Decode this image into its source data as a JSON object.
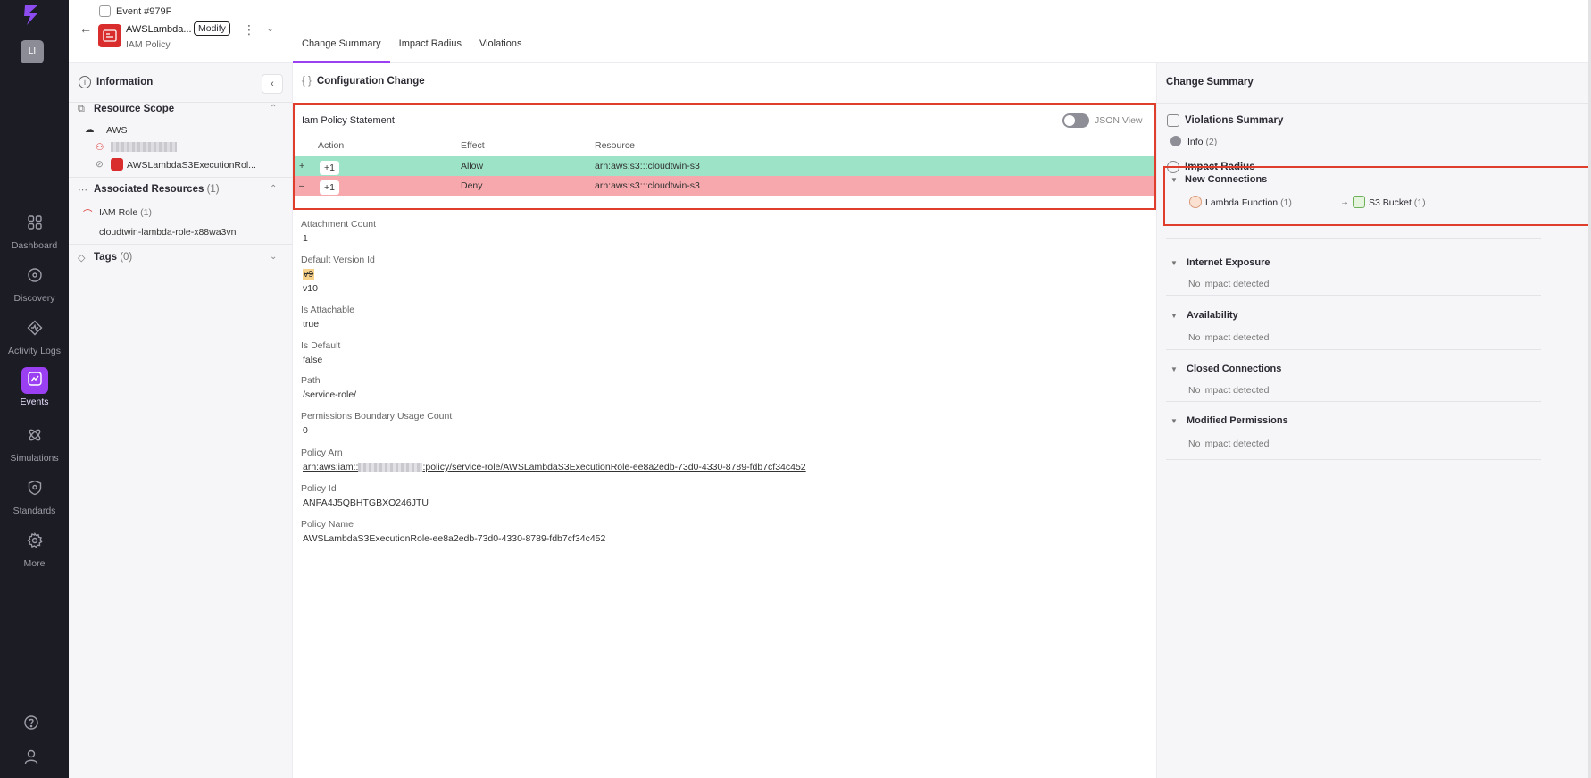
{
  "nav": {
    "avatar_initials": "LI",
    "items": [
      {
        "label": "Dashboard",
        "icon": "grid-icon"
      },
      {
        "label": "Discovery",
        "icon": "compass-icon"
      },
      {
        "label": "Activity Logs",
        "icon": "pulse-icon"
      },
      {
        "label": "Events",
        "icon": "chart-icon"
      },
      {
        "label": "Simulations",
        "icon": "atom-icon"
      },
      {
        "label": "Standards",
        "icon": "shield-icon"
      },
      {
        "label": "More",
        "icon": "gear-icon"
      }
    ],
    "active_item": "Events",
    "accent_color": "#9b3ff2"
  },
  "header": {
    "event_id": "Event #979F",
    "resource_name": "AWSLambda...",
    "modify_label": "Modify",
    "resource_type": "IAM Policy",
    "tabs": [
      {
        "label": "Change Summary",
        "active": true
      },
      {
        "label": "Impact Radius",
        "active": false
      },
      {
        "label": "Violations",
        "active": false
      }
    ]
  },
  "info_panel": {
    "title": "Information",
    "resource_scope": {
      "title": "Resource Scope",
      "provider": "AWS",
      "resource": "AWSLambdaS3ExecutionRol..."
    },
    "associated_resources": {
      "title": "Associated Resources",
      "count": "(1)",
      "role_type": "IAM Role",
      "role_count": "(1)",
      "role_name": "cloudtwin-lambda-role-x88wa3vn"
    },
    "tags": {
      "title": "Tags",
      "count": "(0)"
    }
  },
  "main": {
    "section_title": "Configuration Change",
    "statement": {
      "title": "Iam Policy Statement",
      "json_view_label": "JSON View",
      "headers": [
        "Action",
        "Effect",
        "Resource"
      ],
      "rows": [
        {
          "sign": "+",
          "action": "+1",
          "effect": "Allow",
          "resource": "arn:aws:s3:::cloudtwin-s3",
          "color": "#9ce3c7"
        },
        {
          "sign": "–",
          "action": "+1",
          "effect": "Deny",
          "resource": "arn:aws:s3:::cloudtwin-s3",
          "color": "#f6a8ad"
        }
      ]
    },
    "properties": {
      "attachment_count_label": "Attachment Count",
      "attachment_count": "1",
      "default_version_label": "Default Version Id",
      "default_version_old": "v9",
      "default_version_new": "v10",
      "is_attachable_label": "Is Attachable",
      "is_attachable": "true",
      "is_default_label": "Is Default",
      "is_default": "false",
      "path_label": "Path",
      "path": "/service-role/",
      "pb_usage_label": "Permissions Boundary Usage Count",
      "pb_usage": "0",
      "policy_arn_label": "Policy Arn",
      "policy_arn_prefix": "arn:aws:iam::",
      "policy_arn_suffix": ":policy/service-role/AWSLambdaS3ExecutionRole-ee8a2edb-73d0-4330-8789-fdb7cf34c452",
      "policy_id_label": "Policy Id",
      "policy_id": "ANPA4J5QBHTGBXO246JTU",
      "policy_name_label": "Policy Name",
      "policy_name": "AWSLambdaS3ExecutionRole-ee8a2edb-73d0-4330-8789-fdb7cf34c452"
    }
  },
  "right_panel": {
    "title": "Change Summary",
    "violations_title": "Violations Summary",
    "info_label": "Info",
    "info_count": "(2)",
    "impact_title": "Impact Radius",
    "new_connections": {
      "title": "New Connections",
      "source": "Lambda Function",
      "source_count": "(1)",
      "target": "S3 Bucket",
      "target_count": "(1)"
    },
    "sections": [
      {
        "title": "Internet Exposure",
        "status": "No impact detected"
      },
      {
        "title": "Availability",
        "status": "No impact detected"
      },
      {
        "title": "Closed Connections",
        "status": "No impact detected"
      },
      {
        "title": "Modified Permissions",
        "status": "No impact detected"
      }
    ]
  }
}
